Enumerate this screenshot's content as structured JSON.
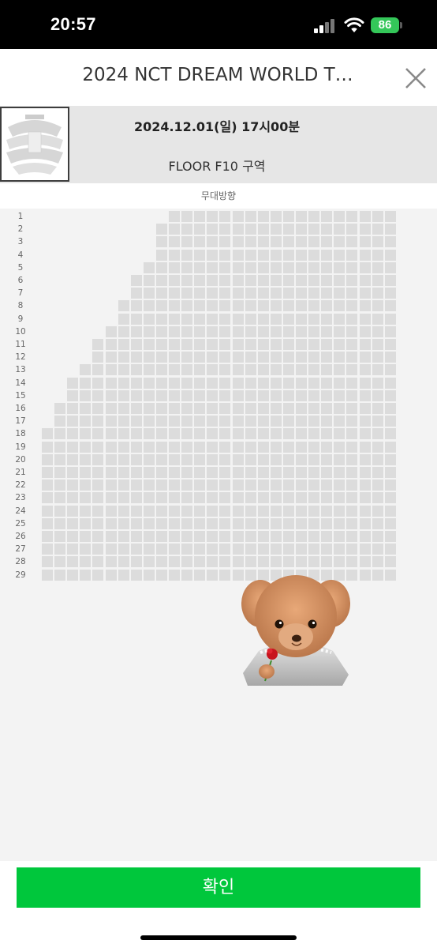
{
  "status_bar": {
    "time": "20:57",
    "battery": "86"
  },
  "header": {
    "title": "2024 NCT DREAM WORLD T…",
    "close_icon": "close-icon"
  },
  "event": {
    "date": "2024.12.01(일) 17시00분",
    "section": "FLOOR F10 구역"
  },
  "stage_label": "무대방향",
  "rows": [
    "1",
    "2",
    "3",
    "4",
    "5",
    "6",
    "7",
    "8",
    "9",
    "10",
    "11",
    "12",
    "13",
    "14",
    "15",
    "16",
    "17",
    "18",
    "19",
    "20",
    "21",
    "22",
    "23",
    "24",
    "25",
    "26",
    "27",
    "28",
    "29"
  ],
  "seat_map": {
    "row_first_column": [
      10,
      9,
      9,
      9,
      8,
      7,
      7,
      6,
      6,
      5,
      4,
      4,
      3,
      2,
      2,
      1,
      1,
      0,
      0,
      0,
      0,
      0,
      0,
      0,
      0,
      0,
      0,
      0,
      0
    ],
    "columns": 28,
    "seat_color": "#dcdcdc"
  },
  "colors": {
    "confirm": "#00c73c",
    "battery": "#34c759"
  },
  "confirm_label": "확인"
}
